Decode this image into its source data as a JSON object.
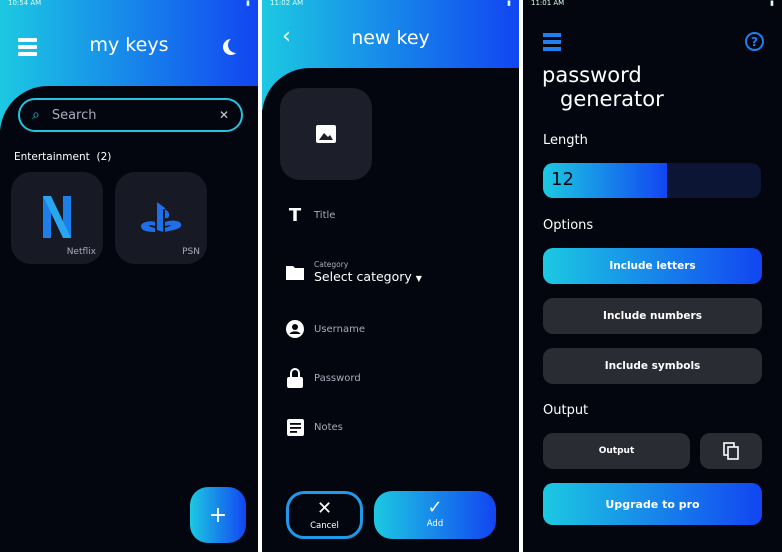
{
  "colors": {
    "accent_start": "#1cc9e2",
    "accent_end": "#1245f2",
    "background": "#04060f",
    "tile": "#171a24"
  },
  "screen1": {
    "status_time": "10:54 AM",
    "title": "my keys",
    "search_placeholder": "Search",
    "category": "Entertainment",
    "category_count": "(2)",
    "items": [
      {
        "label": "Netflix",
        "icon": "netflix-logo"
      },
      {
        "label": "PSN",
        "icon": "playstation-logo"
      }
    ],
    "fab": "+"
  },
  "screen2": {
    "status_time": "11:02 AM",
    "title": "new key",
    "fields": {
      "title": "Title",
      "category_label": "Category",
      "category_value": "Select category",
      "username": "Username",
      "password": "Password",
      "notes": "Notes"
    },
    "cancel": "Cancel",
    "add": "Add"
  },
  "screen3": {
    "status_time": "11:01 AM",
    "title_line1": "password",
    "title_line2": "generator",
    "length_label": "Length",
    "length_value": "12",
    "length_fraction": 0.57,
    "options_label": "Options",
    "options": [
      "Include letters",
      "Include numbers",
      "Include symbols"
    ],
    "options_selected": [
      true,
      false,
      false
    ],
    "output_label": "Output",
    "output_value": "Output",
    "upgrade": "Upgrade to pro"
  }
}
